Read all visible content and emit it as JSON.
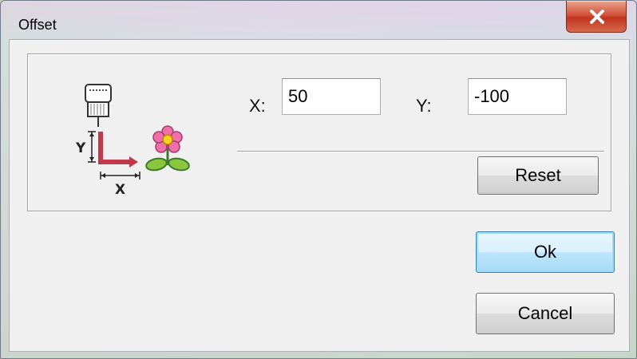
{
  "window": {
    "title": "Offset",
    "close_icon": "close-x-icon"
  },
  "offset": {
    "x_label": "X:",
    "x_value": "50",
    "y_label": "Y:",
    "y_value": "-100"
  },
  "illustration": {
    "icons": [
      "embroidery-machine-icon",
      "offset-arrow-icon",
      "flower-icon"
    ],
    "y_axis_letter": "Y",
    "x_axis_letter": "X"
  },
  "buttons": {
    "reset": "Reset",
    "ok": "Ok",
    "cancel": "Cancel"
  },
  "colors": {
    "close_button": "#d3533b",
    "default_button_border": "#3c7fb1",
    "flower_petals": "#f06fa8",
    "arrow": "#c0394b"
  }
}
